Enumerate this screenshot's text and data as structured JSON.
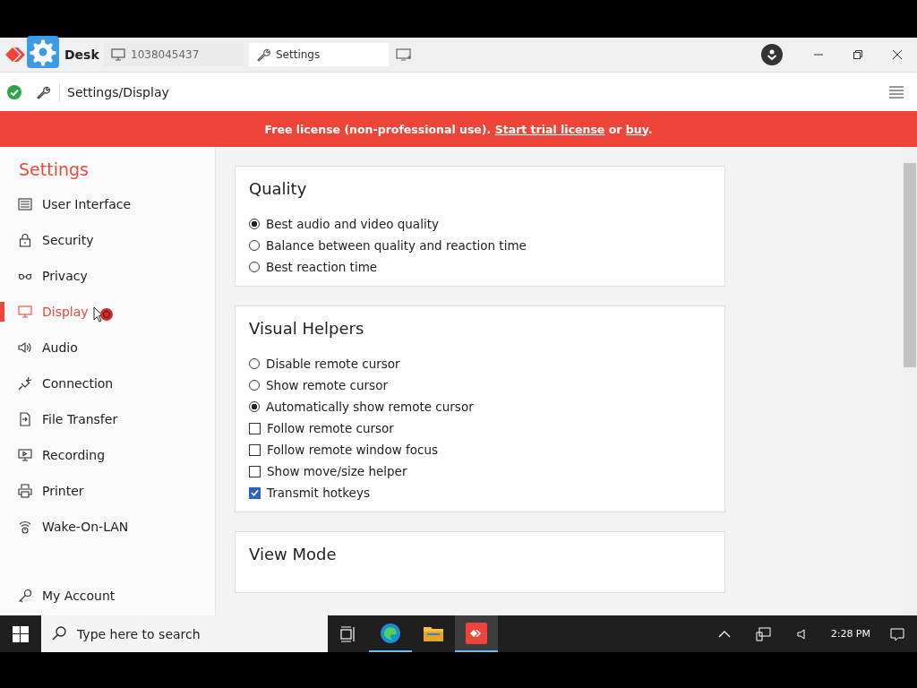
{
  "title_bar": {
    "logo": "Desk",
    "tabs": [
      {
        "label": "1038045437",
        "kind": "remote",
        "selected": false
      },
      {
        "label": "Settings",
        "kind": "settings",
        "selected": true
      }
    ]
  },
  "toolbar": {
    "breadcrumb": "Settings/Display"
  },
  "banner": {
    "text": "Free license (non-professional use). ",
    "trial_link": "Start trial license",
    "middle": " or ",
    "buy_link": "buy",
    "end": "."
  },
  "sidebar": {
    "title": "Settings",
    "items": [
      {
        "label": "User Interface",
        "selected": false
      },
      {
        "label": "Security",
        "selected": false
      },
      {
        "label": "Privacy",
        "selected": false
      },
      {
        "label": "Display",
        "selected": true
      },
      {
        "label": "Audio",
        "selected": false
      },
      {
        "label": "Connection",
        "selected": false
      },
      {
        "label": "File Transfer",
        "selected": false
      },
      {
        "label": "Recording",
        "selected": false
      },
      {
        "label": "Printer",
        "selected": false
      },
      {
        "label": "Wake-On-LAN",
        "selected": false
      }
    ],
    "account": {
      "label": "My Account",
      "selected": false
    }
  },
  "sections": [
    {
      "title": "Quality",
      "options": [
        {
          "kind": "radio",
          "label": "Best audio and video quality",
          "selected": true
        },
        {
          "kind": "radio",
          "label": "Balance between quality and reaction time",
          "selected": false
        },
        {
          "kind": "radio",
          "label": "Best reaction time",
          "selected": false
        }
      ]
    },
    {
      "title": "Visual Helpers",
      "options": [
        {
          "kind": "radio",
          "label": "Disable remote cursor",
          "selected": false
        },
        {
          "kind": "radio",
          "label": "Show remote cursor",
          "selected": false
        },
        {
          "kind": "radio",
          "label": "Automatically show remote cursor",
          "selected": true
        },
        {
          "kind": "checkbox",
          "label": "Follow remote cursor",
          "checked": false
        },
        {
          "kind": "checkbox",
          "label": "Follow remote window focus",
          "checked": false
        },
        {
          "kind": "checkbox",
          "label": "Show move/size helper",
          "checked": false
        },
        {
          "kind": "checkbox",
          "label": "Transmit hotkeys",
          "checked": true
        }
      ]
    },
    {
      "title": "View Mode"
    }
  ],
  "taskbar": {
    "search_placeholder": "Type here to search",
    "time": "2:28 PM"
  }
}
